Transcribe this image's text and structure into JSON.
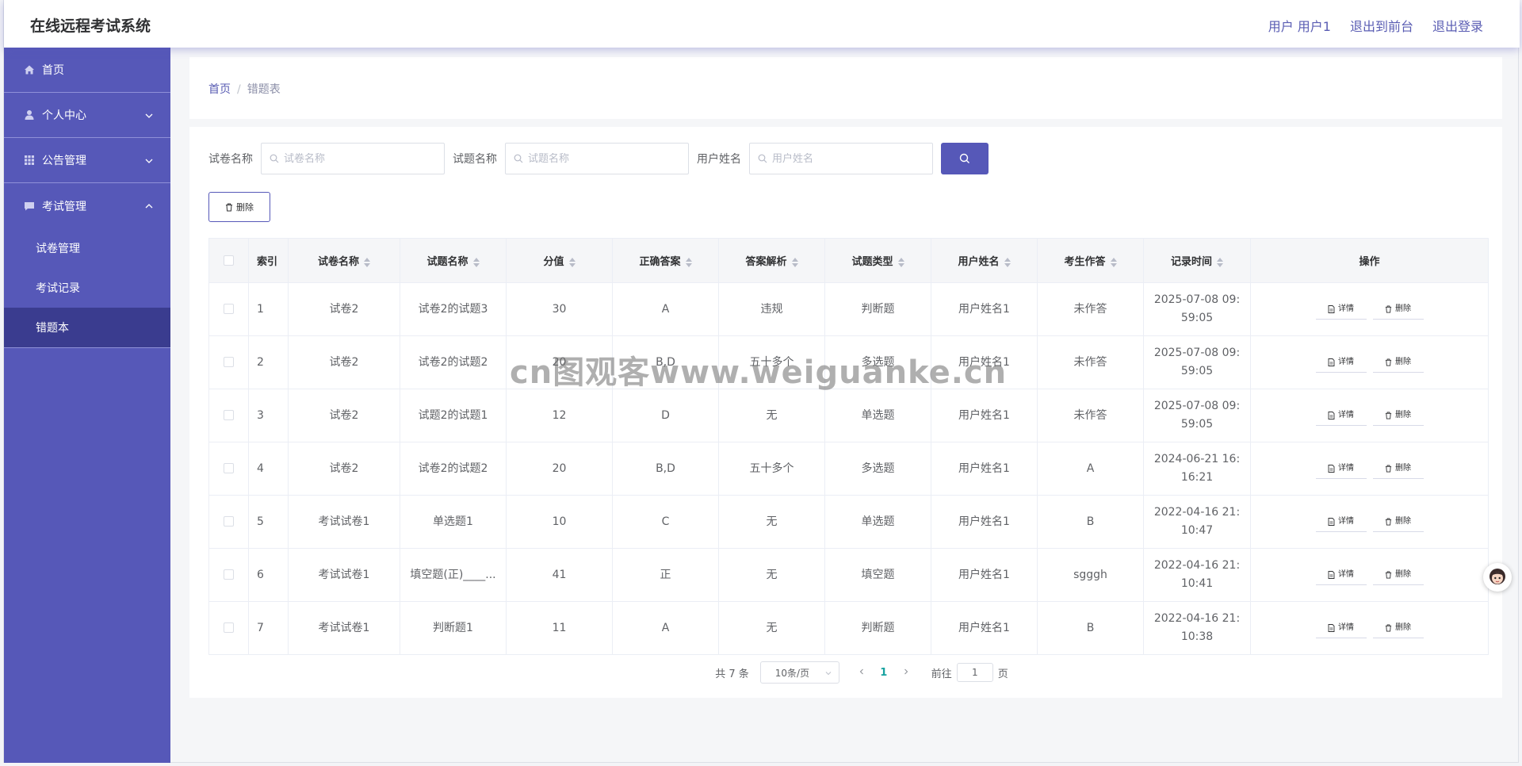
{
  "header": {
    "title": "在线远程考试系统",
    "user_label": "用户 用户1",
    "back_front": "退出到前台",
    "logout": "退出登录"
  },
  "sidebar": {
    "items": [
      {
        "label": "首页",
        "icon": "home-icon"
      },
      {
        "label": "个人中心",
        "icon": "user-icon"
      },
      {
        "label": "公告管理",
        "icon": "grid-icon"
      },
      {
        "label": "考试管理",
        "icon": "chat-icon"
      }
    ],
    "subitems": [
      {
        "label": "试卷管理"
      },
      {
        "label": "考试记录"
      },
      {
        "label": "错题本"
      }
    ]
  },
  "breadcrumb": {
    "home": "首页",
    "sep": "/",
    "current": "错题表"
  },
  "search": {
    "paper_label": "试卷名称",
    "paper_placeholder": "试卷名称",
    "question_label": "试题名称",
    "question_placeholder": "试题名称",
    "user_label": "用户姓名",
    "user_placeholder": "用户姓名"
  },
  "toolbar": {
    "delete_label": "删除"
  },
  "table": {
    "columns": [
      "索引",
      "试卷名称",
      "试题名称",
      "分值",
      "正确答案",
      "答案解析",
      "试题类型",
      "用户姓名",
      "考生作答",
      "记录时间",
      "操作"
    ],
    "rows": [
      {
        "idx": "1",
        "paper": "试卷2",
        "question": "试卷2的试题3",
        "score": "30",
        "answer": "A",
        "analysis": "违规",
        "type": "判断题",
        "user": "用户姓名1",
        "response": "未作答",
        "time": "2025-07-08 09:59:05"
      },
      {
        "idx": "2",
        "paper": "试卷2",
        "question": "试卷2的试题2",
        "score": "20",
        "answer": "B,D",
        "analysis": "五十多个",
        "type": "多选题",
        "user": "用户姓名1",
        "response": "未作答",
        "time": "2025-07-08 09:59:05"
      },
      {
        "idx": "3",
        "paper": "试卷2",
        "question": "试题2的试题1",
        "score": "12",
        "answer": "D",
        "analysis": "无",
        "type": "单选题",
        "user": "用户姓名1",
        "response": "未作答",
        "time": "2025-07-08 09:59:05"
      },
      {
        "idx": "4",
        "paper": "试卷2",
        "question": "试卷2的试题2",
        "score": "20",
        "answer": "B,D",
        "analysis": "五十多个",
        "type": "多选题",
        "user": "用户姓名1",
        "response": "A",
        "time": "2024-06-21 16:16:21"
      },
      {
        "idx": "5",
        "paper": "考试试卷1",
        "question": "单选题1",
        "score": "10",
        "answer": "C",
        "analysis": "无",
        "type": "单选题",
        "user": "用户姓名1",
        "response": "B",
        "time": "2022-04-16 21:10:47"
      },
      {
        "idx": "6",
        "paper": "考试试卷1",
        "question": "填空题(正)____...",
        "score": "41",
        "answer": "正",
        "analysis": "无",
        "type": "填空题",
        "user": "用户姓名1",
        "response": "sgggh",
        "time": "2022-04-16 21:10:41"
      },
      {
        "idx": "7",
        "paper": "考试试卷1",
        "question": "判断题1",
        "score": "11",
        "answer": "A",
        "analysis": "无",
        "type": "判断题",
        "user": "用户姓名1",
        "response": "B",
        "time": "2022-04-16 21:10:38"
      }
    ],
    "detail_label": "详情",
    "delete_label": "删除"
  },
  "pager": {
    "total": "共 7 条",
    "page_size": "10条/页",
    "current_page": "1",
    "goto_label": "前往",
    "goto_value": "1",
    "page_unit": "页"
  },
  "watermark": "cn图观客www.weiguanke.cn",
  "colors": {
    "accent": "#5658b8",
    "active": "#3a3c8f",
    "page_active": "#17a2a0"
  }
}
